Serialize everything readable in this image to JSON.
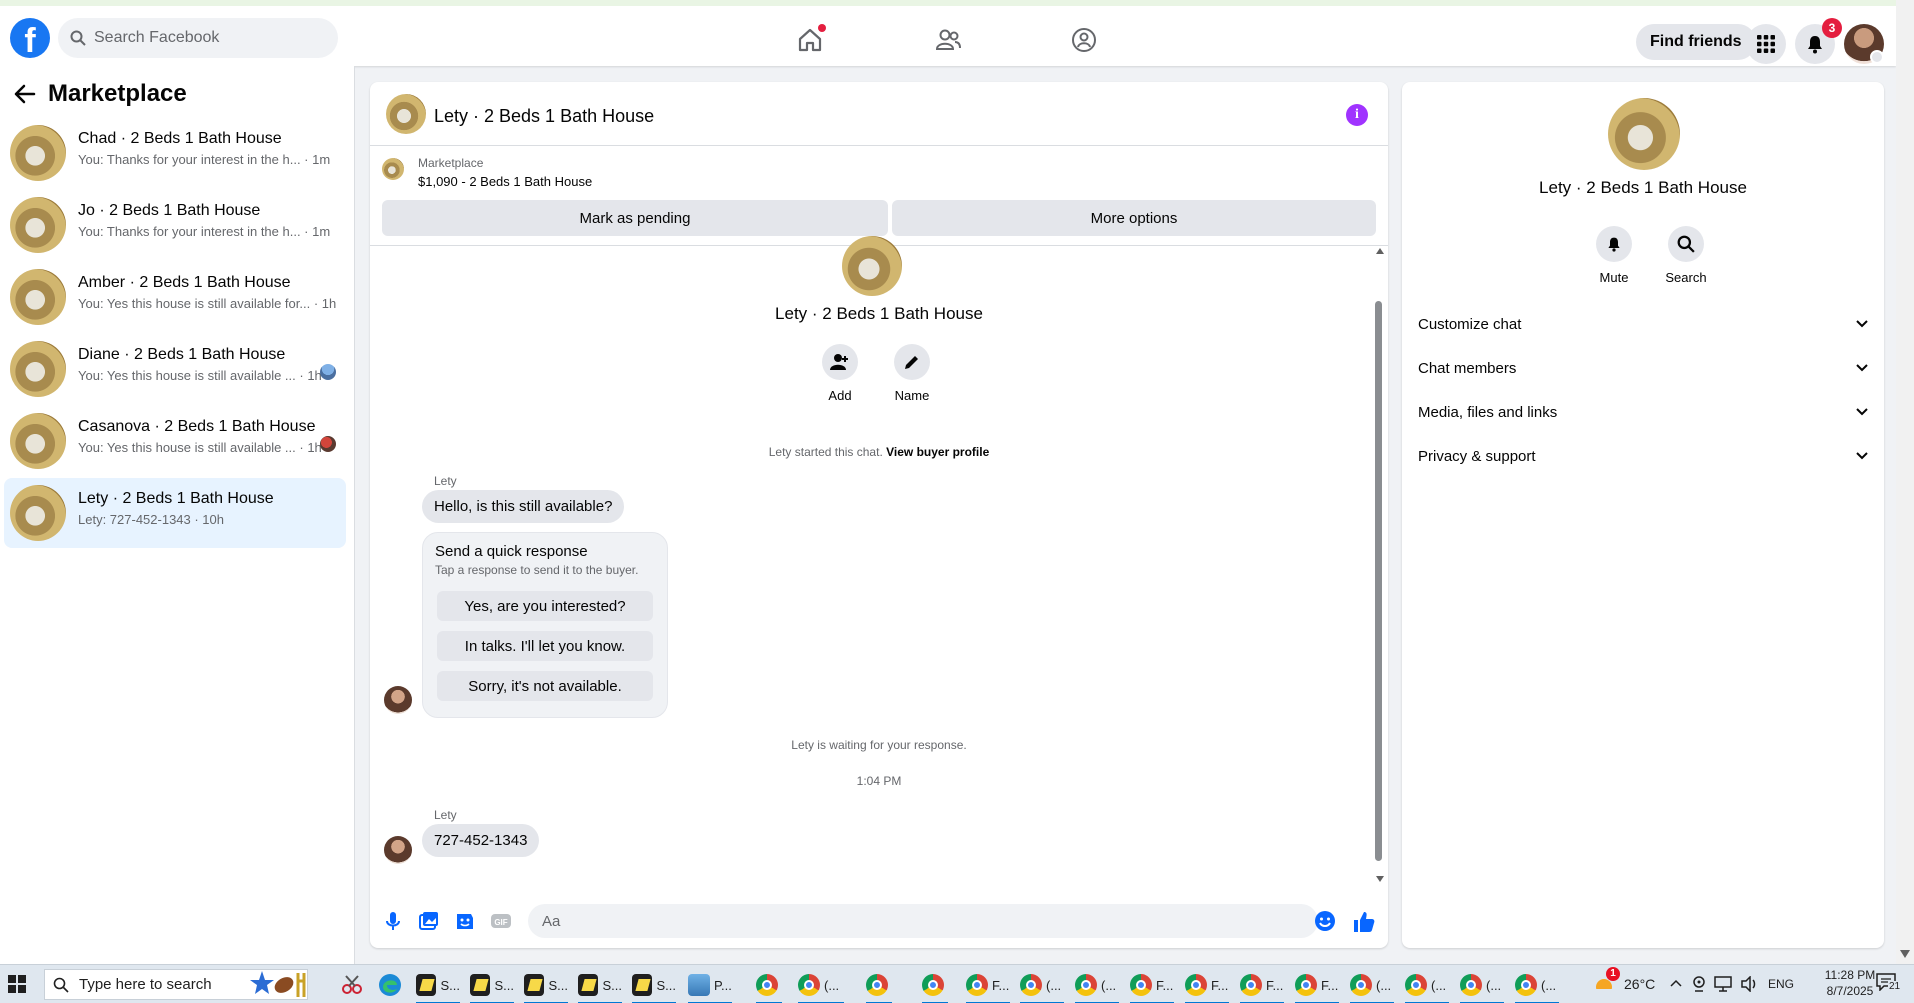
{
  "topbar": {
    "logo": "f",
    "search_placeholder": "Search Facebook",
    "find_friends": "Find friends",
    "notification_count": "3"
  },
  "left": {
    "title": "Marketplace",
    "conversations": [
      {
        "name": "Chad · 2 Beds 1 Bath House",
        "snippet": "You: Thanks for your interest in the h... · 1m"
      },
      {
        "name": "Jo · 2 Beds 1 Bath House",
        "snippet": "You: Thanks for your interest in the h... · 1m"
      },
      {
        "name": "Amber · 2 Beds 1 Bath House",
        "snippet": "You: Yes this house is still available for... · 1h"
      },
      {
        "name": "Diane · 2 Beds 1 Bath House",
        "snippet": "You: Yes this house is still available ... · 1h"
      },
      {
        "name": "Casanova · 2 Beds 1 Bath House",
        "snippet": "You: Yes this house is still available ... · 1h"
      },
      {
        "name": "Lety · 2 Beds 1 Bath House",
        "snippet": "Lety: 727-452-1343 · 10h"
      }
    ]
  },
  "chat": {
    "title": "Lety · 2 Beds 1 Bath House",
    "listing_label": "Marketplace",
    "listing_price": "$1,090 - 2 Beds 1 Bath House",
    "mark_pending": "Mark as pending",
    "more_options": "More options",
    "center_title": "Lety · 2 Beds 1 Bath House",
    "add_label": "Add",
    "name_label": "Name",
    "started_text": "Lety started this chat.",
    "view_buyer_profile": "View buyer profile",
    "sender_name": "Lety",
    "message1": "Hello, is this still available?",
    "quick_title": "Send a quick response",
    "quick_subtitle": "Tap a response to send it to the buyer.",
    "quick_responses": [
      "Yes, are you interested?",
      "In talks. I'll let you know.",
      "Sorry, it's not available."
    ],
    "waiting_text": "Lety is waiting for your response.",
    "timestamp": "1:04 PM",
    "message2": "727-452-1343",
    "input_placeholder": "Aa"
  },
  "right": {
    "title": "Lety · 2 Beds 1 Bath House",
    "mute": "Mute",
    "search": "Search",
    "sections": [
      "Customize chat",
      "Chat members",
      "Media, files and links",
      "Privacy & support"
    ]
  },
  "taskbar": {
    "search_placeholder": "Type here to search",
    "apps": [
      "S...",
      "S...",
      "S...",
      "S...",
      "S...",
      "P...",
      "",
      "(...",
      "",
      "",
      "F...",
      "(...",
      "(...",
      "F...",
      "F...",
      "F...",
      "F...",
      "(...",
      "(...",
      "(...",
      "(..."
    ],
    "weather": "26°C",
    "weather_badge": "1",
    "lang": "ENG",
    "time": "11:28 PM",
    "date": "8/7/2025",
    "notif_count": "21"
  },
  "colors": {
    "brand": "#1877f2",
    "active_bg": "#e7f3ff",
    "badge": "#e41e3f",
    "info": "#a033ff"
  }
}
